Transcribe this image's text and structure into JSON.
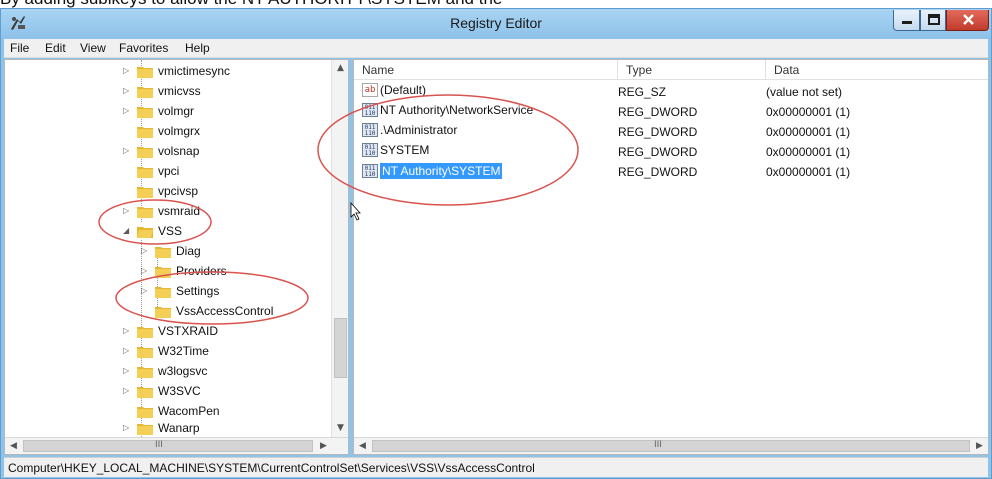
{
  "top_caption": "By adding sublkeys to allow the NT AUTHORITY\\SYSTEM and the",
  "window": {
    "title": "Registry Editor",
    "buttons": [
      "minimize",
      "maximize",
      "close"
    ]
  },
  "menu": [
    "File",
    "Edit",
    "View",
    "Favorites",
    "Help"
  ],
  "tree": {
    "items": [
      {
        "label": "vmictimesync",
        "expander": "collapsed"
      },
      {
        "label": "vmicvss",
        "expander": "collapsed"
      },
      {
        "label": "volmgr",
        "expander": "collapsed"
      },
      {
        "label": "volmgrx",
        "expander": "none"
      },
      {
        "label": "volsnap",
        "expander": "collapsed"
      },
      {
        "label": "vpci",
        "expander": "none"
      },
      {
        "label": "vpcivsp",
        "expander": "none"
      },
      {
        "label": "vsmraid",
        "expander": "collapsed"
      },
      {
        "label": "VSS",
        "expander": "expanded"
      },
      {
        "label": "Diag",
        "expander": "collapsed"
      },
      {
        "label": "Providers",
        "expander": "collapsed"
      },
      {
        "label": "Settings",
        "expander": "collapsed"
      },
      {
        "label": "VssAccessControl",
        "expander": "none"
      },
      {
        "label": "VSTXRAID",
        "expander": "collapsed"
      },
      {
        "label": "W32Time",
        "expander": "collapsed"
      },
      {
        "label": "w3logsvc",
        "expander": "collapsed"
      },
      {
        "label": "W3SVC",
        "expander": "collapsed"
      },
      {
        "label": "WacomPen",
        "expander": "none"
      },
      {
        "label": "Wanarp",
        "expander": "collapsed"
      }
    ]
  },
  "values": {
    "columns": [
      "Name",
      "Type",
      "Data"
    ],
    "rows": [
      {
        "name": "(Default)",
        "type": "REG_SZ",
        "data": "(value not set)",
        "icon": "string-value-icon",
        "selected": false
      },
      {
        "name": "NT Authority\\NetworkService",
        "type": "REG_DWORD",
        "data": "0x00000001 (1)",
        "icon": "dword-value-icon",
        "selected": false
      },
      {
        "name": ".\\Administrator",
        "type": "REG_DWORD",
        "data": "0x00000001 (1)",
        "icon": "dword-value-icon",
        "selected": false
      },
      {
        "name": "SYSTEM",
        "type": "REG_DWORD",
        "data": "0x00000001 (1)",
        "icon": "dword-value-icon",
        "selected": false
      },
      {
        "name": "NT Authority\\SYSTEM",
        "type": "REG_DWORD",
        "data": "0x00000001 (1)",
        "icon": "dword-value-icon",
        "selected": true
      }
    ]
  },
  "scrollbar_glyph": "III",
  "status_path": "Computer\\HKEY_LOCAL_MACHINE\\SYSTEM\\CurrentControlSet\\Services\\VSS\\VssAccessControl",
  "colors": {
    "titlebar": "#8dc1e8",
    "selection": "#3399ff",
    "folder": "#e8b731",
    "annotation": "#d9534f",
    "close_button": "#c13b2c"
  }
}
